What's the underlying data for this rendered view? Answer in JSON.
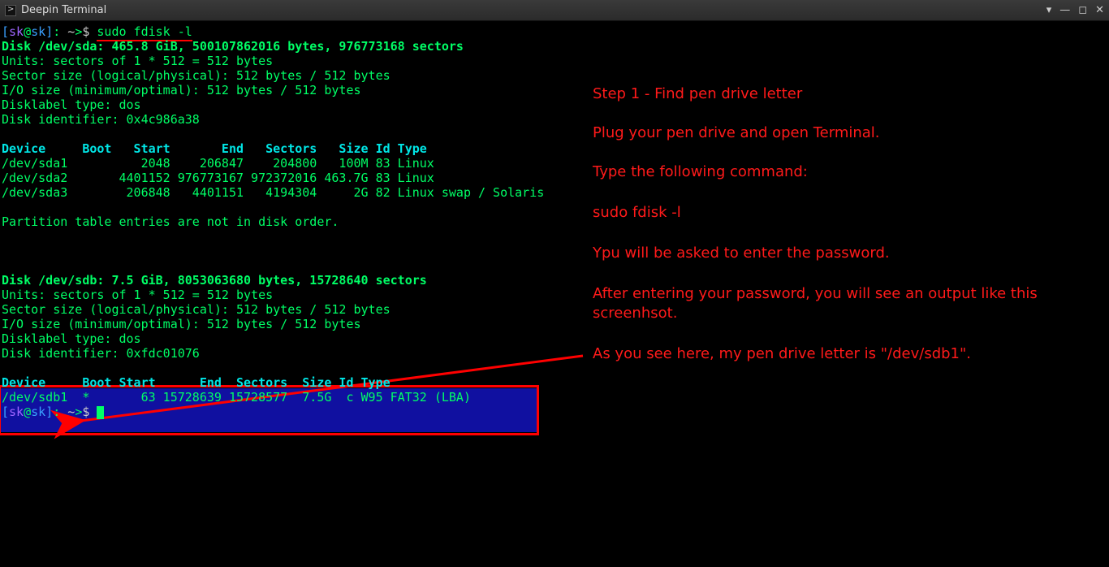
{
  "window": {
    "title": "Deepin Terminal"
  },
  "prompt": {
    "user": "sk",
    "host": "sk",
    "path": "~",
    "symbol": "$"
  },
  "command1": "sudo fdisk -l",
  "disk_sda": {
    "header": "Disk /dev/sda: 465.8 GiB, 500107862016 bytes, 976773168 sectors",
    "units": "Units: sectors of 1 * 512 = 512 bytes",
    "sector": "Sector size (logical/physical): 512 bytes / 512 bytes",
    "io": "I/O size (minimum/optimal): 512 bytes / 512 bytes",
    "label": "Disklabel type: dos",
    "ident": "Disk identifier: 0x4c986a38",
    "table_header": "Device     Boot   Start       End   Sectors   Size Id Type",
    "rows": [
      "/dev/sda1          2048    206847    204800   100M 83 Linux",
      "/dev/sda2       4401152 976773167 972372016 463.7G 83 Linux",
      "/dev/sda3        206848   4401151   4194304     2G 82 Linux swap / Solaris"
    ],
    "note": "Partition table entries are not in disk order."
  },
  "disk_sdb": {
    "header": "Disk /dev/sdb: 7.5 GiB, 8053063680 bytes, 15728640 sectors",
    "units": "Units: sectors of 1 * 512 = 512 bytes",
    "sector": "Sector size (logical/physical): 512 bytes / 512 bytes",
    "io": "I/O size (minimum/optimal): 512 bytes / 512 bytes",
    "label": "Disklabel type: dos",
    "ident": "Disk identifier: 0xfdc01076",
    "table_header": "Device     Boot Start      End  Sectors  Size Id Type",
    "rows": [
      "/dev/sdb1  *       63 15728639 15728577  7.5G  c W95 FAT32 (LBA)"
    ]
  },
  "instructions": {
    "step": "Step 1 - Find pen drive letter",
    "p1": "Plug your pen drive and open Terminal.",
    "p2": "Type the following command:",
    "p3": "sudo fdisk -l",
    "p4": "Ypu will be asked to enter the password.",
    "p5": "After entering your password, you will see an output like this screenhsot.",
    "p6": "As you see here, my pen drive letter is \"/dev/sdb1\"."
  }
}
